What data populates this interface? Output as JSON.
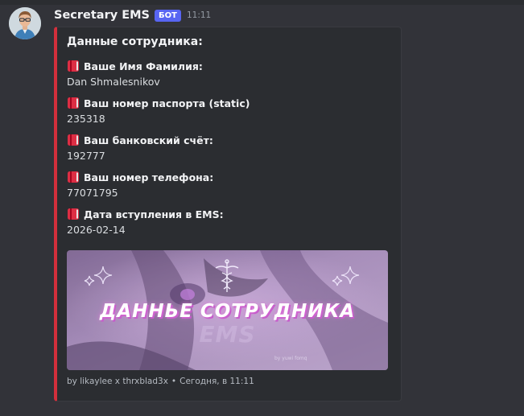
{
  "message": {
    "author": "Secretary EMS",
    "bot_tag": "БОТ",
    "time": "11:11"
  },
  "embed": {
    "accent_color": "#d32f3c",
    "title": "Данные сотрудника:",
    "fields": [
      {
        "icon": "red-book-icon",
        "name": "Ваше Имя Фамилия:",
        "value": "Dan Shmalesnikov"
      },
      {
        "icon": "red-book-icon",
        "name": "Ваш номер паспорта (static)",
        "value": "235318"
      },
      {
        "icon": "red-book-icon",
        "name": "Ваш банковский счёт:",
        "value": "192777"
      },
      {
        "icon": "red-book-icon",
        "name": "Ваш номер телефона:",
        "value": "77071795"
      },
      {
        "icon": "red-book-icon",
        "name": "Дата вступления в EMS:",
        "value": "2026-02-14"
      }
    ],
    "image": {
      "title": "ДАННЬЕ СОТРУДНИКА",
      "subtitle": "EMS",
      "credit": "by yuwi fomq"
    },
    "footer": {
      "text": "by likaylee x thrxblad3x",
      "separator": "•",
      "timestamp": "Сегодня, в 11:11"
    }
  }
}
